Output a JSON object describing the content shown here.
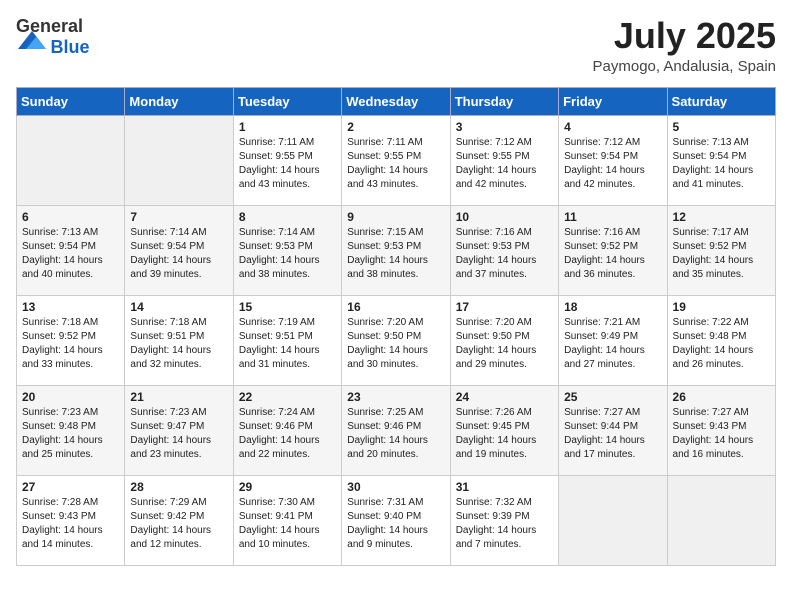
{
  "header": {
    "logo_general": "General",
    "logo_blue": "Blue",
    "month_year": "July 2025",
    "location": "Paymogo, Andalusia, Spain"
  },
  "columns": [
    "Sunday",
    "Monday",
    "Tuesday",
    "Wednesday",
    "Thursday",
    "Friday",
    "Saturday"
  ],
  "weeks": [
    [
      {
        "day": "",
        "info": ""
      },
      {
        "day": "",
        "info": ""
      },
      {
        "day": "1",
        "info": "Sunrise: 7:11 AM\nSunset: 9:55 PM\nDaylight: 14 hours and 43 minutes."
      },
      {
        "day": "2",
        "info": "Sunrise: 7:11 AM\nSunset: 9:55 PM\nDaylight: 14 hours and 43 minutes."
      },
      {
        "day": "3",
        "info": "Sunrise: 7:12 AM\nSunset: 9:55 PM\nDaylight: 14 hours and 42 minutes."
      },
      {
        "day": "4",
        "info": "Sunrise: 7:12 AM\nSunset: 9:54 PM\nDaylight: 14 hours and 42 minutes."
      },
      {
        "day": "5",
        "info": "Sunrise: 7:13 AM\nSunset: 9:54 PM\nDaylight: 14 hours and 41 minutes."
      }
    ],
    [
      {
        "day": "6",
        "info": "Sunrise: 7:13 AM\nSunset: 9:54 PM\nDaylight: 14 hours and 40 minutes."
      },
      {
        "day": "7",
        "info": "Sunrise: 7:14 AM\nSunset: 9:54 PM\nDaylight: 14 hours and 39 minutes."
      },
      {
        "day": "8",
        "info": "Sunrise: 7:14 AM\nSunset: 9:53 PM\nDaylight: 14 hours and 38 minutes."
      },
      {
        "day": "9",
        "info": "Sunrise: 7:15 AM\nSunset: 9:53 PM\nDaylight: 14 hours and 38 minutes."
      },
      {
        "day": "10",
        "info": "Sunrise: 7:16 AM\nSunset: 9:53 PM\nDaylight: 14 hours and 37 minutes."
      },
      {
        "day": "11",
        "info": "Sunrise: 7:16 AM\nSunset: 9:52 PM\nDaylight: 14 hours and 36 minutes."
      },
      {
        "day": "12",
        "info": "Sunrise: 7:17 AM\nSunset: 9:52 PM\nDaylight: 14 hours and 35 minutes."
      }
    ],
    [
      {
        "day": "13",
        "info": "Sunrise: 7:18 AM\nSunset: 9:52 PM\nDaylight: 14 hours and 33 minutes."
      },
      {
        "day": "14",
        "info": "Sunrise: 7:18 AM\nSunset: 9:51 PM\nDaylight: 14 hours and 32 minutes."
      },
      {
        "day": "15",
        "info": "Sunrise: 7:19 AM\nSunset: 9:51 PM\nDaylight: 14 hours and 31 minutes."
      },
      {
        "day": "16",
        "info": "Sunrise: 7:20 AM\nSunset: 9:50 PM\nDaylight: 14 hours and 30 minutes."
      },
      {
        "day": "17",
        "info": "Sunrise: 7:20 AM\nSunset: 9:50 PM\nDaylight: 14 hours and 29 minutes."
      },
      {
        "day": "18",
        "info": "Sunrise: 7:21 AM\nSunset: 9:49 PM\nDaylight: 14 hours and 27 minutes."
      },
      {
        "day": "19",
        "info": "Sunrise: 7:22 AM\nSunset: 9:48 PM\nDaylight: 14 hours and 26 minutes."
      }
    ],
    [
      {
        "day": "20",
        "info": "Sunrise: 7:23 AM\nSunset: 9:48 PM\nDaylight: 14 hours and 25 minutes."
      },
      {
        "day": "21",
        "info": "Sunrise: 7:23 AM\nSunset: 9:47 PM\nDaylight: 14 hours and 23 minutes."
      },
      {
        "day": "22",
        "info": "Sunrise: 7:24 AM\nSunset: 9:46 PM\nDaylight: 14 hours and 22 minutes."
      },
      {
        "day": "23",
        "info": "Sunrise: 7:25 AM\nSunset: 9:46 PM\nDaylight: 14 hours and 20 minutes."
      },
      {
        "day": "24",
        "info": "Sunrise: 7:26 AM\nSunset: 9:45 PM\nDaylight: 14 hours and 19 minutes."
      },
      {
        "day": "25",
        "info": "Sunrise: 7:27 AM\nSunset: 9:44 PM\nDaylight: 14 hours and 17 minutes."
      },
      {
        "day": "26",
        "info": "Sunrise: 7:27 AM\nSunset: 9:43 PM\nDaylight: 14 hours and 16 minutes."
      }
    ],
    [
      {
        "day": "27",
        "info": "Sunrise: 7:28 AM\nSunset: 9:43 PM\nDaylight: 14 hours and 14 minutes."
      },
      {
        "day": "28",
        "info": "Sunrise: 7:29 AM\nSunset: 9:42 PM\nDaylight: 14 hours and 12 minutes."
      },
      {
        "day": "29",
        "info": "Sunrise: 7:30 AM\nSunset: 9:41 PM\nDaylight: 14 hours and 10 minutes."
      },
      {
        "day": "30",
        "info": "Sunrise: 7:31 AM\nSunset: 9:40 PM\nDaylight: 14 hours and 9 minutes."
      },
      {
        "day": "31",
        "info": "Sunrise: 7:32 AM\nSunset: 9:39 PM\nDaylight: 14 hours and 7 minutes."
      },
      {
        "day": "",
        "info": ""
      },
      {
        "day": "",
        "info": ""
      }
    ]
  ]
}
